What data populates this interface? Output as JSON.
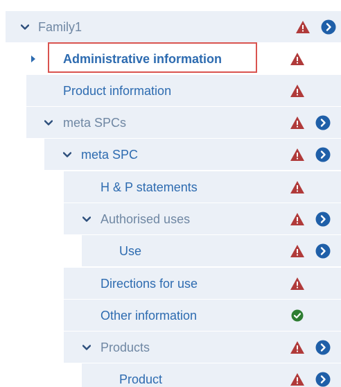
{
  "tree": {
    "items": [
      {
        "label": "Family1",
        "status": "warning",
        "expandable": true,
        "expanded": true,
        "navigable": true
      },
      {
        "label": "Administrative information",
        "status": "warning",
        "expandable": false,
        "selected": true,
        "navigable": false
      },
      {
        "label": "Product information",
        "status": "warning",
        "expandable": false,
        "navigable": false
      },
      {
        "label": "meta SPCs",
        "status": "warning",
        "expandable": true,
        "expanded": true,
        "navigable": true
      },
      {
        "label": "meta SPC",
        "status": "warning",
        "expandable": true,
        "expanded": true,
        "navigable": true
      },
      {
        "label": "H & P statements",
        "status": "warning",
        "expandable": false,
        "navigable": false
      },
      {
        "label": "Authorised uses",
        "status": "warning",
        "expandable": true,
        "expanded": true,
        "navigable": true
      },
      {
        "label": "Use",
        "status": "warning",
        "expandable": false,
        "navigable": true
      },
      {
        "label": "Directions for use",
        "status": "warning",
        "expandable": false,
        "navigable": false
      },
      {
        "label": "Other information",
        "status": "ok",
        "expandable": false,
        "navigable": false
      },
      {
        "label": "Products",
        "status": "warning",
        "expandable": true,
        "expanded": true,
        "navigable": true
      },
      {
        "label": "Product",
        "status": "warning",
        "expandable": false,
        "navigable": true
      }
    ]
  },
  "colors": {
    "row_background": "#ebf0f7",
    "label_link": "#2d6bb0",
    "label_muted": "#6f87a3",
    "warning_red": "#b03a3a",
    "ok_green": "#2e7d32",
    "nav_blue": "#1f5fa8",
    "selection_outline": "#d9534f"
  }
}
